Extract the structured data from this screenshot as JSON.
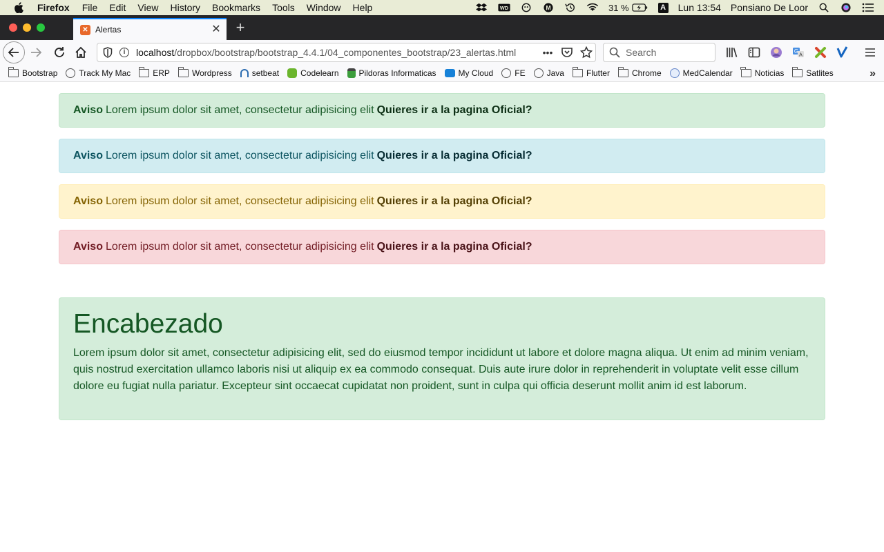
{
  "menubar": {
    "app_name": "Firefox",
    "items": [
      "File",
      "Edit",
      "View",
      "History",
      "Bookmarks",
      "Tools",
      "Window",
      "Help"
    ],
    "battery": "31 %",
    "input_source": "A",
    "clock": "Lun 13:54",
    "user": "Ponsiano De Loor"
  },
  "tab": {
    "title": "Alertas"
  },
  "navbar": {
    "url_host": "localhost",
    "url_path": "/dropbox/bootstrap/bootstrap_4.4.1/04_componentes_bootstrap/23_alertas.html",
    "search_placeholder": "Search"
  },
  "bookmarks": [
    {
      "label": "Bootstrap",
      "icon": "folder"
    },
    {
      "label": "Track My Mac",
      "icon": "globe"
    },
    {
      "label": "ERP",
      "icon": "folder"
    },
    {
      "label": "Wordpress",
      "icon": "folder"
    },
    {
      "label": "setbeat",
      "icon": "setbeat"
    },
    {
      "label": "Codelearn",
      "icon": "green"
    },
    {
      "label": "Pildoras Informaticas",
      "icon": "stack"
    },
    {
      "label": "My Cloud",
      "icon": "cloud"
    },
    {
      "label": "FE",
      "icon": "globe"
    },
    {
      "label": "Java",
      "icon": "globe"
    },
    {
      "label": "Flutter",
      "icon": "folder"
    },
    {
      "label": "Chrome",
      "icon": "folder"
    },
    {
      "label": "MedCalendar",
      "icon": "med"
    },
    {
      "label": "Noticias",
      "icon": "folder"
    },
    {
      "label": "Satlites",
      "icon": "folder"
    }
  ],
  "alerts": [
    {
      "strong": "Aviso",
      "text": "Lorem ipsum dolor sit amet, consectetur adipisicing elit",
      "link": "Quieres ir a la pagina Oficial?"
    },
    {
      "strong": "Aviso",
      "text": "Lorem ipsum dolor sit amet, consectetur adipisicing elit",
      "link": "Quieres ir a la pagina Oficial?"
    },
    {
      "strong": "Aviso",
      "text": "Lorem ipsum dolor sit amet, consectetur adipisicing elit",
      "link": "Quieres ir a la pagina Oficial?"
    },
    {
      "strong": "Aviso",
      "text": "Lorem ipsum dolor sit amet, consectetur adipisicing elit",
      "link": "Quieres ir a la pagina Oficial?"
    }
  ],
  "big_alert": {
    "heading": "Encabezado",
    "body": "Lorem ipsum dolor sit amet, consectetur adipisicing elit, sed do eiusmod tempor incididunt ut labore et dolore magna aliqua. Ut enim ad minim veniam, quis nostrud exercitation ullamco laboris nisi ut aliquip ex ea commodo consequat. Duis aute irure dolor in reprehenderit in voluptate velit esse cillum dolore eu fugiat nulla pariatur. Excepteur sint occaecat cupidatat non proident, sunt in culpa qui officia deserunt mollit anim id est laborum."
  },
  "colors": {
    "success_bg": "#d4edda",
    "info_bg": "#d1ecf1",
    "warning_bg": "#fff3cd",
    "danger_bg": "#f8d7da"
  }
}
